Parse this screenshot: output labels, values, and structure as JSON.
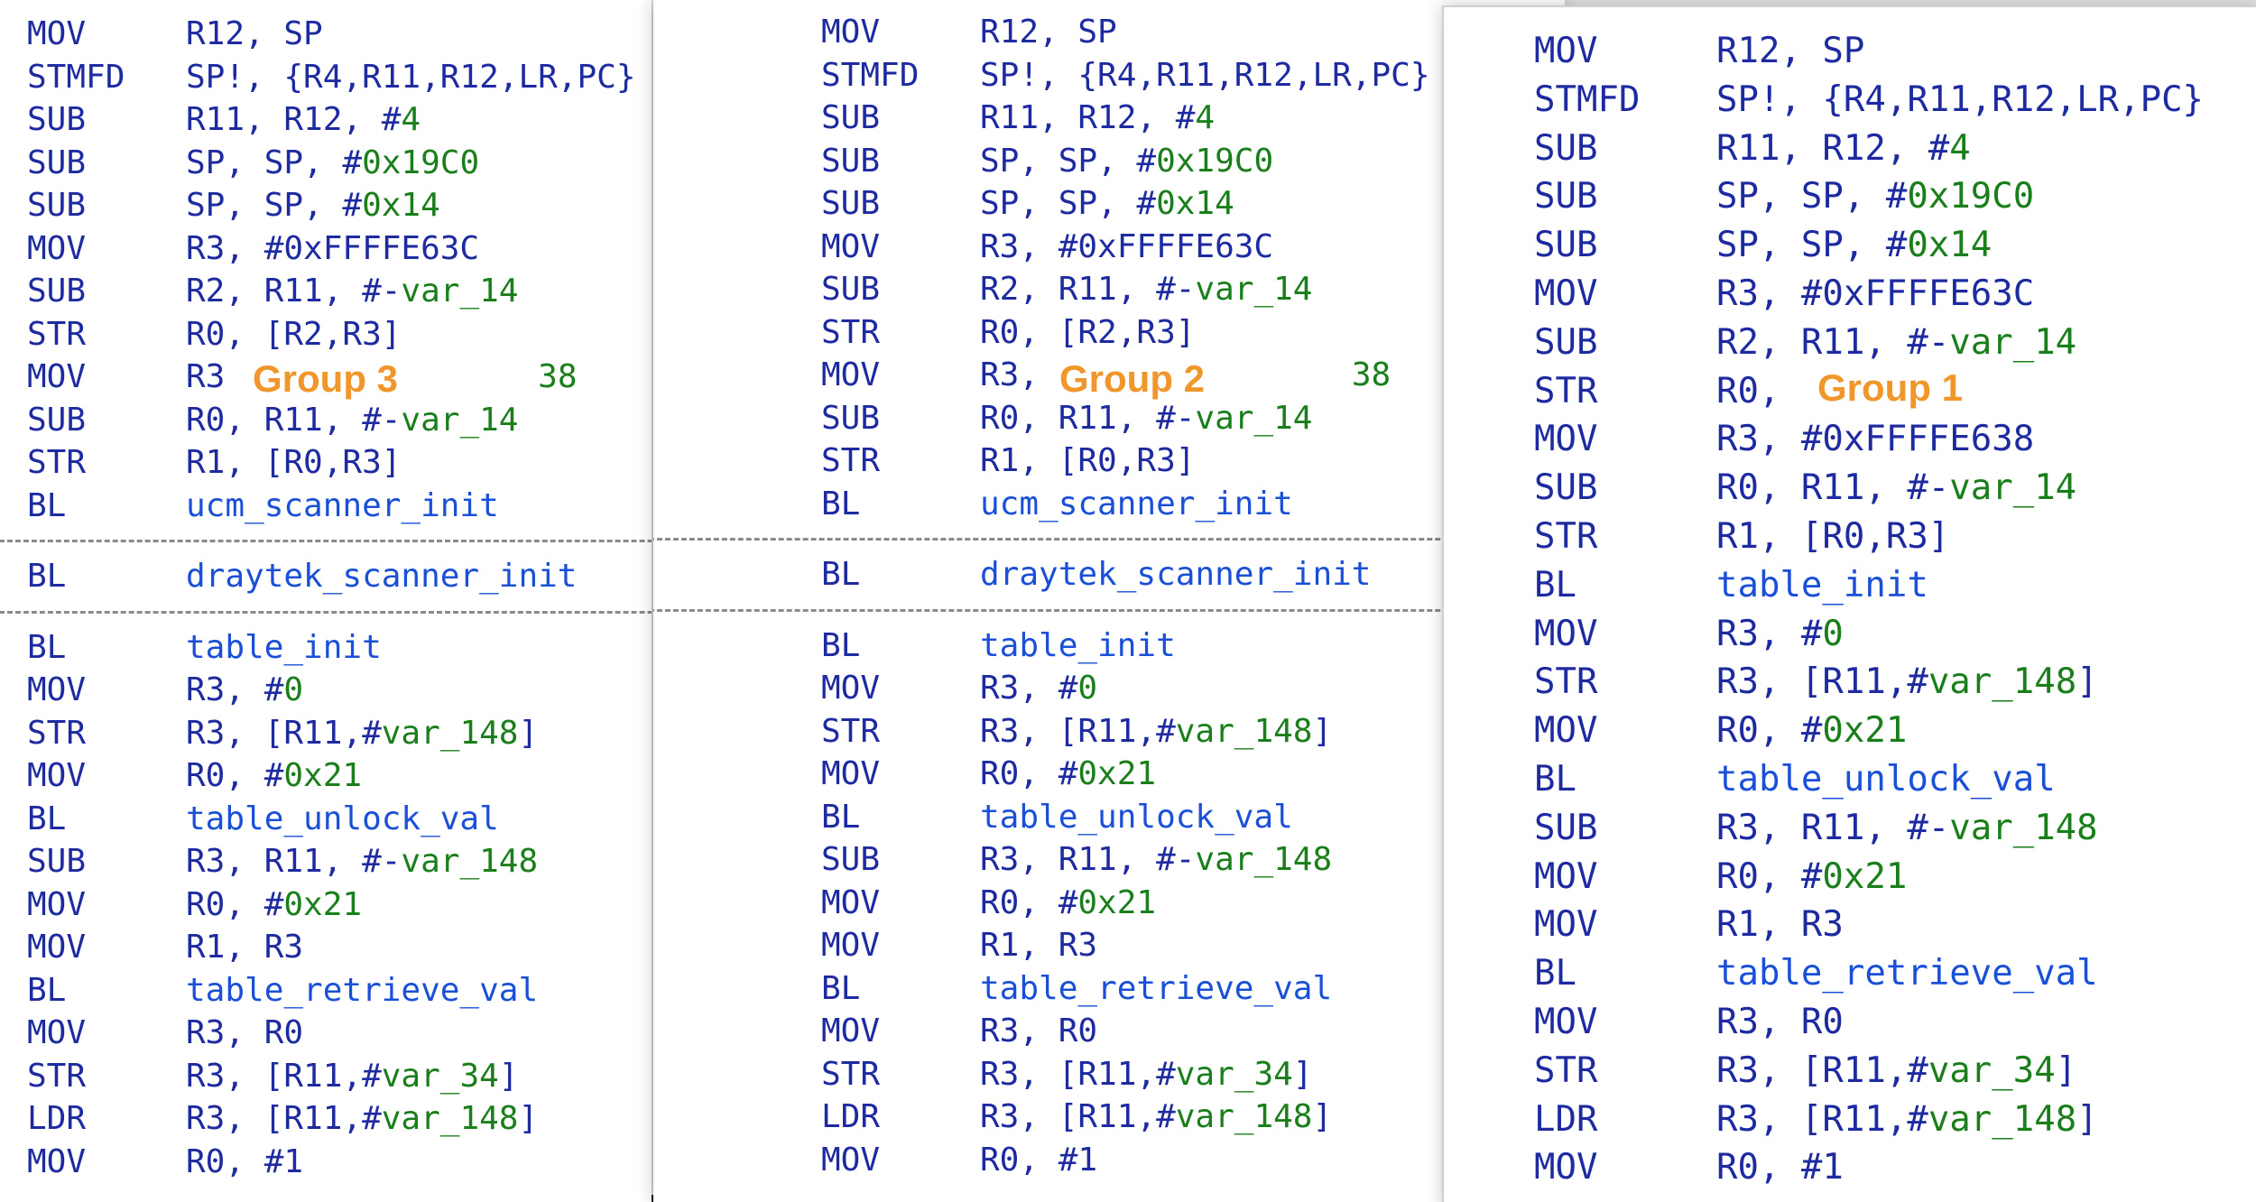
{
  "colors": {
    "mnemonic": "#1e2aa0",
    "immediate": "#1a7e1a",
    "symbol": "#1a4fd8",
    "group_label": "#f0962a",
    "separator": "#8a8a8a"
  },
  "panels": [
    {
      "id": "group-3",
      "group_label": "Group 3",
      "blocks": [
        [
          {
            "mn": "MOV",
            "ops": [
              {
                "t": "R12, SP"
              }
            ]
          },
          {
            "mn": "STMFD",
            "ops": [
              {
                "t": "SP!, {R4,R11,R12,LR,PC}"
              }
            ]
          },
          {
            "mn": "SUB",
            "ops": [
              {
                "t": "R11, R12, #"
              },
              {
                "t": "4",
                "c": "num"
              }
            ]
          },
          {
            "mn": "SUB",
            "ops": [
              {
                "t": "SP, SP, #"
              },
              {
                "t": "0x19C0",
                "c": "num"
              }
            ]
          },
          {
            "mn": "SUB",
            "ops": [
              {
                "t": "SP, SP, #"
              },
              {
                "t": "0x14",
                "c": "num"
              }
            ]
          },
          {
            "mn": "MOV",
            "ops": [
              {
                "t": "R3, #0xFFFFE63C"
              }
            ]
          },
          {
            "mn": "SUB",
            "ops": [
              {
                "t": "R2, R11, #-"
              },
              {
                "t": "var_14",
                "c": "num"
              }
            ]
          },
          {
            "mn": "STR",
            "ops": [
              {
                "t": "R0, [R2,R3]"
              }
            ]
          },
          {
            "mn": "MOV",
            "ops": [
              {
                "t": "R3"
              },
              {
                "t": "                38",
                "c": "num"
              }
            ]
          },
          {
            "mn": "SUB",
            "ops": [
              {
                "t": "R0, R11, #-"
              },
              {
                "t": "var_14",
                "c": "num"
              }
            ]
          },
          {
            "mn": "STR",
            "ops": [
              {
                "t": "R1, [R0,R3]"
              }
            ]
          },
          {
            "mn": "BL",
            "ops": [
              {
                "t": "ucm_scanner_init",
                "c": "sym"
              }
            ]
          }
        ],
        [
          {
            "mn": "BL",
            "ops": [
              {
                "t": "draytek_scanner_init",
                "c": "sym"
              }
            ]
          }
        ],
        [
          {
            "mn": "BL",
            "ops": [
              {
                "t": "table_init",
                "c": "sym"
              }
            ]
          },
          {
            "mn": "MOV",
            "ops": [
              {
                "t": "R3, #"
              },
              {
                "t": "0",
                "c": "num"
              }
            ]
          },
          {
            "mn": "STR",
            "ops": [
              {
                "t": "R3, [R11,#"
              },
              {
                "t": "var_148",
                "c": "num"
              },
              {
                "t": "]"
              }
            ]
          },
          {
            "mn": "MOV",
            "ops": [
              {
                "t": "R0, #"
              },
              {
                "t": "0x21",
                "c": "num"
              }
            ]
          },
          {
            "mn": "BL",
            "ops": [
              {
                "t": "table_unlock_val",
                "c": "sym"
              }
            ]
          },
          {
            "mn": "SUB",
            "ops": [
              {
                "t": "R3, R11, #-"
              },
              {
                "t": "var_148",
                "c": "num"
              }
            ]
          },
          {
            "mn": "MOV",
            "ops": [
              {
                "t": "R0, #"
              },
              {
                "t": "0x21",
                "c": "num"
              }
            ]
          },
          {
            "mn": "MOV",
            "ops": [
              {
                "t": "R1, R3"
              }
            ]
          },
          {
            "mn": "BL",
            "ops": [
              {
                "t": "table_retrieve_val",
                "c": "sym"
              }
            ]
          },
          {
            "mn": "MOV",
            "ops": [
              {
                "t": "R3, R0"
              }
            ]
          },
          {
            "mn": "STR",
            "ops": [
              {
                "t": "R3, [R11,#"
              },
              {
                "t": "var_34",
                "c": "num"
              },
              {
                "t": "]"
              }
            ]
          },
          {
            "mn": "LDR",
            "ops": [
              {
                "t": "R3, [R11,#"
              },
              {
                "t": "var_148",
                "c": "num"
              },
              {
                "t": "]"
              }
            ]
          },
          {
            "mn": "MOV",
            "ops": [
              {
                "t": "R0, #1"
              }
            ]
          }
        ]
      ]
    },
    {
      "id": "group-2",
      "group_label": "Group 2",
      "blocks": [
        [
          {
            "mn": "MOV",
            "ops": [
              {
                "t": "R12, SP"
              }
            ]
          },
          {
            "mn": "STMFD",
            "ops": [
              {
                "t": "SP!, {R4,R11,R12,LR,PC}"
              }
            ]
          },
          {
            "mn": "SUB",
            "ops": [
              {
                "t": "R11, R12, #"
              },
              {
                "t": "4",
                "c": "num"
              }
            ]
          },
          {
            "mn": "SUB",
            "ops": [
              {
                "t": "SP, SP, #"
              },
              {
                "t": "0x19C0",
                "c": "num"
              }
            ]
          },
          {
            "mn": "SUB",
            "ops": [
              {
                "t": "SP, SP, #"
              },
              {
                "t": "0x14",
                "c": "num"
              }
            ]
          },
          {
            "mn": "MOV",
            "ops": [
              {
                "t": "R3, #0xFFFFE63C"
              }
            ]
          },
          {
            "mn": "SUB",
            "ops": [
              {
                "t": "R2, R11, #-"
              },
              {
                "t": "var_14",
                "c": "num"
              }
            ]
          },
          {
            "mn": "STR",
            "ops": [
              {
                "t": "R0, [R2,R3]"
              }
            ]
          },
          {
            "mn": "MOV",
            "ops": [
              {
                "t": "R3,"
              },
              {
                "t": "                38",
                "c": "num"
              }
            ]
          },
          {
            "mn": "SUB",
            "ops": [
              {
                "t": "R0, R11, #-"
              },
              {
                "t": "var_14",
                "c": "num"
              }
            ]
          },
          {
            "mn": "STR",
            "ops": [
              {
                "t": "R1, [R0,R3]"
              }
            ]
          },
          {
            "mn": "BL",
            "ops": [
              {
                "t": "ucm_scanner_init",
                "c": "sym"
              }
            ]
          }
        ],
        [
          {
            "mn": "BL",
            "ops": [
              {
                "t": "draytek_scanner_init",
                "c": "sym"
              }
            ]
          }
        ],
        [
          {
            "mn": "BL",
            "ops": [
              {
                "t": "table_init",
                "c": "sym"
              }
            ]
          },
          {
            "mn": "MOV",
            "ops": [
              {
                "t": "R3, #"
              },
              {
                "t": "0",
                "c": "num"
              }
            ]
          },
          {
            "mn": "STR",
            "ops": [
              {
                "t": "R3, [R11,#"
              },
              {
                "t": "var_148",
                "c": "num"
              },
              {
                "t": "]"
              }
            ]
          },
          {
            "mn": "MOV",
            "ops": [
              {
                "t": "R0, #"
              },
              {
                "t": "0x21",
                "c": "num"
              }
            ]
          },
          {
            "mn": "BL",
            "ops": [
              {
                "t": "table_unlock_val",
                "c": "sym"
              }
            ]
          },
          {
            "mn": "SUB",
            "ops": [
              {
                "t": "R3, R11, #-"
              },
              {
                "t": "var_148",
                "c": "num"
              }
            ]
          },
          {
            "mn": "MOV",
            "ops": [
              {
                "t": "R0, #"
              },
              {
                "t": "0x21",
                "c": "num"
              }
            ]
          },
          {
            "mn": "MOV",
            "ops": [
              {
                "t": "R1, R3"
              }
            ]
          },
          {
            "mn": "BL",
            "ops": [
              {
                "t": "table_retrieve_val",
                "c": "sym"
              }
            ]
          },
          {
            "mn": "MOV",
            "ops": [
              {
                "t": "R3, R0"
              }
            ]
          },
          {
            "mn": "STR",
            "ops": [
              {
                "t": "R3, [R11,#"
              },
              {
                "t": "var_34",
                "c": "num"
              },
              {
                "t": "]"
              }
            ]
          },
          {
            "mn": "LDR",
            "ops": [
              {
                "t": "R3, [R11,#"
              },
              {
                "t": "var_148",
                "c": "num"
              },
              {
                "t": "]"
              }
            ]
          },
          {
            "mn": "MOV",
            "ops": [
              {
                "t": "R0, #1"
              }
            ]
          }
        ]
      ]
    },
    {
      "id": "group-1",
      "group_label": "Group 1",
      "blocks": [
        [
          {
            "mn": "MOV",
            "ops": [
              {
                "t": "R12, SP"
              }
            ]
          },
          {
            "mn": "STMFD",
            "ops": [
              {
                "t": "SP!, {R4,R11,R12,LR,PC}"
              }
            ]
          },
          {
            "mn": "SUB",
            "ops": [
              {
                "t": "R11, R12, #"
              },
              {
                "t": "4",
                "c": "num"
              }
            ]
          },
          {
            "mn": "SUB",
            "ops": [
              {
                "t": "SP, SP, #"
              },
              {
                "t": "0x19C0",
                "c": "num"
              }
            ]
          },
          {
            "mn": "SUB",
            "ops": [
              {
                "t": "SP, SP, #"
              },
              {
                "t": "0x14",
                "c": "num"
              }
            ]
          },
          {
            "mn": "MOV",
            "ops": [
              {
                "t": "R3, #0xFFFFE63C"
              }
            ]
          },
          {
            "mn": "SUB",
            "ops": [
              {
                "t": "R2, R11, #-"
              },
              {
                "t": "var_14",
                "c": "num"
              }
            ]
          },
          {
            "mn": "STR",
            "ops": [
              {
                "t": "R0,"
              }
            ]
          },
          {
            "mn": "MOV",
            "ops": [
              {
                "t": "R3, #0xFFFFE638"
              }
            ]
          },
          {
            "mn": "SUB",
            "ops": [
              {
                "t": "R0, R11, #-"
              },
              {
                "t": "var_14",
                "c": "num"
              }
            ]
          },
          {
            "mn": "STR",
            "ops": [
              {
                "t": "R1, [R0,R3]"
              }
            ]
          },
          {
            "mn": "BL",
            "ops": [
              {
                "t": "table_init",
                "c": "sym"
              }
            ]
          },
          {
            "mn": "MOV",
            "ops": [
              {
                "t": "R3, #"
              },
              {
                "t": "0",
                "c": "num"
              }
            ]
          },
          {
            "mn": "STR",
            "ops": [
              {
                "t": "R3, [R11,#"
              },
              {
                "t": "var_148",
                "c": "num"
              },
              {
                "t": "]"
              }
            ]
          },
          {
            "mn": "MOV",
            "ops": [
              {
                "t": "R0, #"
              },
              {
                "t": "0x21",
                "c": "num"
              }
            ]
          },
          {
            "mn": "BL",
            "ops": [
              {
                "t": "table_unlock_val",
                "c": "sym"
              }
            ]
          },
          {
            "mn": "SUB",
            "ops": [
              {
                "t": "R3, R11, #-"
              },
              {
                "t": "var_148",
                "c": "num"
              }
            ]
          },
          {
            "mn": "MOV",
            "ops": [
              {
                "t": "R0, #"
              },
              {
                "t": "0x21",
                "c": "num"
              }
            ]
          },
          {
            "mn": "MOV",
            "ops": [
              {
                "t": "R1, R3"
              }
            ]
          },
          {
            "mn": "BL",
            "ops": [
              {
                "t": "table_retrieve_val",
                "c": "sym"
              }
            ]
          },
          {
            "mn": "MOV",
            "ops": [
              {
                "t": "R3, R0"
              }
            ]
          },
          {
            "mn": "STR",
            "ops": [
              {
                "t": "R3, [R11,#"
              },
              {
                "t": "var_34",
                "c": "num"
              },
              {
                "t": "]"
              }
            ]
          },
          {
            "mn": "LDR",
            "ops": [
              {
                "t": "R3, [R11,#"
              },
              {
                "t": "var_148",
                "c": "num"
              },
              {
                "t": "]"
              }
            ]
          },
          {
            "mn": "MOV",
            "ops": [
              {
                "t": "R0, #1"
              }
            ]
          }
        ]
      ]
    }
  ]
}
